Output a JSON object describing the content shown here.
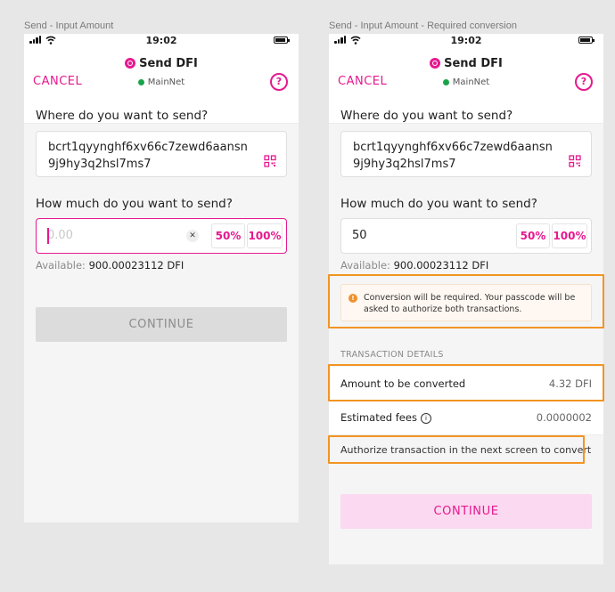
{
  "left_frame": {
    "label": "Send - Input Amount",
    "status": {
      "time": "19:02"
    },
    "header": {
      "cancel": "CANCEL",
      "title": "Send DFI",
      "network": "MainNet"
    },
    "address_label": "Where do you want to send?",
    "address_value": "bcrt1qyynghf6xv66c7zewd6aansn9j9hy3q2hsl7ms7",
    "amount_label": "How much do you want to send?",
    "amount_placeholder": "0.00",
    "pct_50": "50%",
    "pct_100": "100%",
    "available_prefix": "Available:",
    "available_value": "900.00023112 DFI",
    "continue": "CONTINUE"
  },
  "right_frame": {
    "label": "Send - Input Amount - Required conversion",
    "status": {
      "time": "19:02"
    },
    "header": {
      "cancel": "CANCEL",
      "title": "Send DFI",
      "network": "MainNet"
    },
    "address_label": "Where do you want to send?",
    "address_value": "bcrt1qyynghf6xv66c7zewd6aansn9j9hy3q2hsl7ms7",
    "amount_label": "How much do you want to send?",
    "amount_value": "50",
    "pct_50": "50%",
    "pct_100": "100%",
    "available_prefix": "Available:",
    "available_value": "900.00023112 DFI",
    "warning": "Conversion will be required. Your passcode will be asked to authorize both transactions.",
    "details_title": "TRANSACTION DETAILS",
    "converted_label": "Amount to be converted",
    "converted_value": "4.32 DFI",
    "fees_label": "Estimated fees",
    "fees_value": "0.0000002",
    "authorize_note": "Authorize transaction in the next screen to convert",
    "continue": "CONTINUE"
  },
  "colors": {
    "accent": "#e6198f",
    "highlight": "#f29423",
    "network": "#1ca34a"
  }
}
